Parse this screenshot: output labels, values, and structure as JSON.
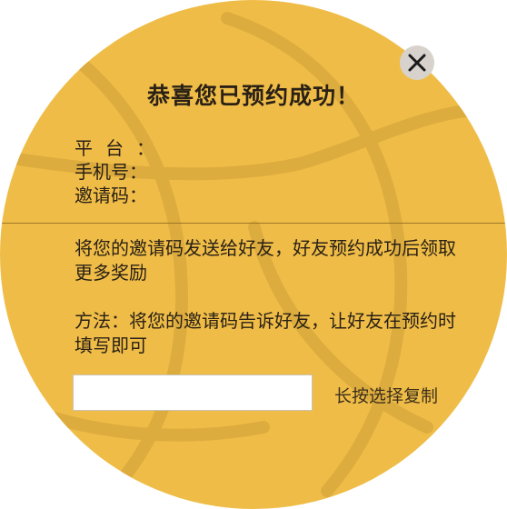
{
  "dialog": {
    "title": "恭喜您已预约成功！",
    "close_icon": "close-icon"
  },
  "info": {
    "platform_label": "平台",
    "phone_label": "手机号",
    "invite_code_label": "邀请码",
    "colon": "："
  },
  "instructions": {
    "share_text": "将您的邀请码发送给好友，好友预约成功后领取更多奖励",
    "method_text": "方法：将您的邀请码告诉好友，让好友在预约时填写即可"
  },
  "invite_code_field": {
    "value": ""
  },
  "copy_hint": "长按选择复制",
  "colors": {
    "ball": "#EFBD47",
    "seam": "#DDAC3E",
    "divider": "#9C7624",
    "text": "#2A2016",
    "close_button": "#D7D3CC"
  }
}
